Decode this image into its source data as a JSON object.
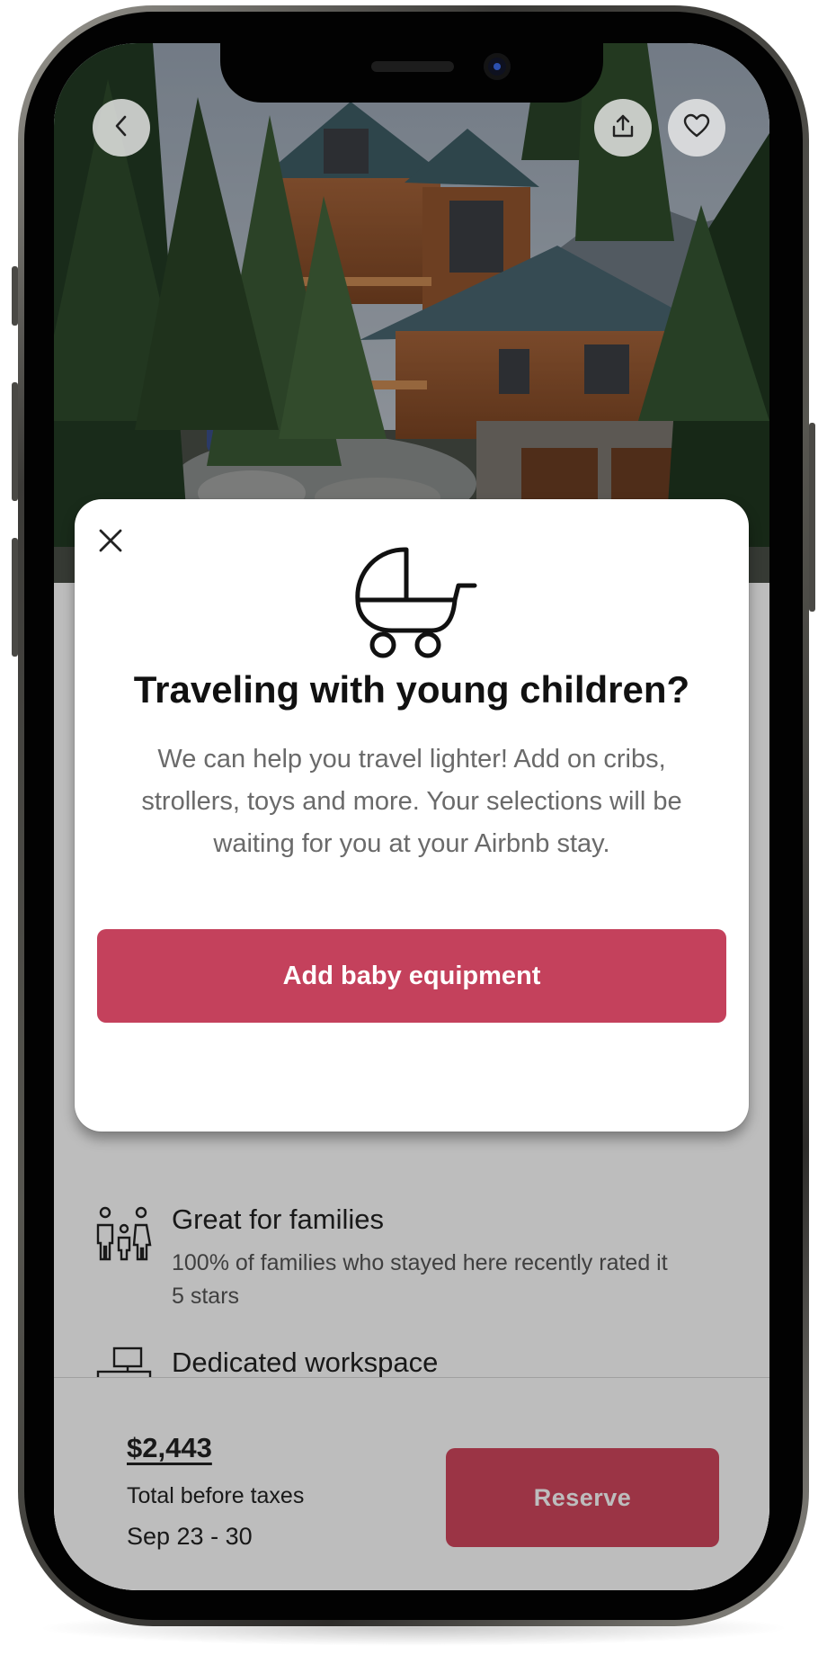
{
  "header": {
    "back_icon": "chevron-left-icon",
    "share_icon": "share-icon",
    "favorite_icon": "heart-icon"
  },
  "modal": {
    "close_icon": "close-icon",
    "illustration_icon": "stroller-icon",
    "title": "Traveling with young children?",
    "body": "We can help you travel lighter! Add on cribs, strollers, toys and more. Your selections will be waiting for you at your Airbnb stay.",
    "cta_label": "Add baby equipment"
  },
  "features": [
    {
      "icon": "family-icon",
      "title": "Great for families",
      "description": "100% of families who stayed here recently rated it 5 stars"
    },
    {
      "icon": "workspace-icon",
      "title": "Dedicated workspace",
      "description": ""
    }
  ],
  "booking": {
    "price": "$2,443",
    "price_caption": "Total before taxes",
    "dates": "Sep 23 - 30",
    "reserve_label": "Reserve"
  },
  "colors": {
    "brand": "#d2475e",
    "modal_cta": "#c4415c"
  }
}
